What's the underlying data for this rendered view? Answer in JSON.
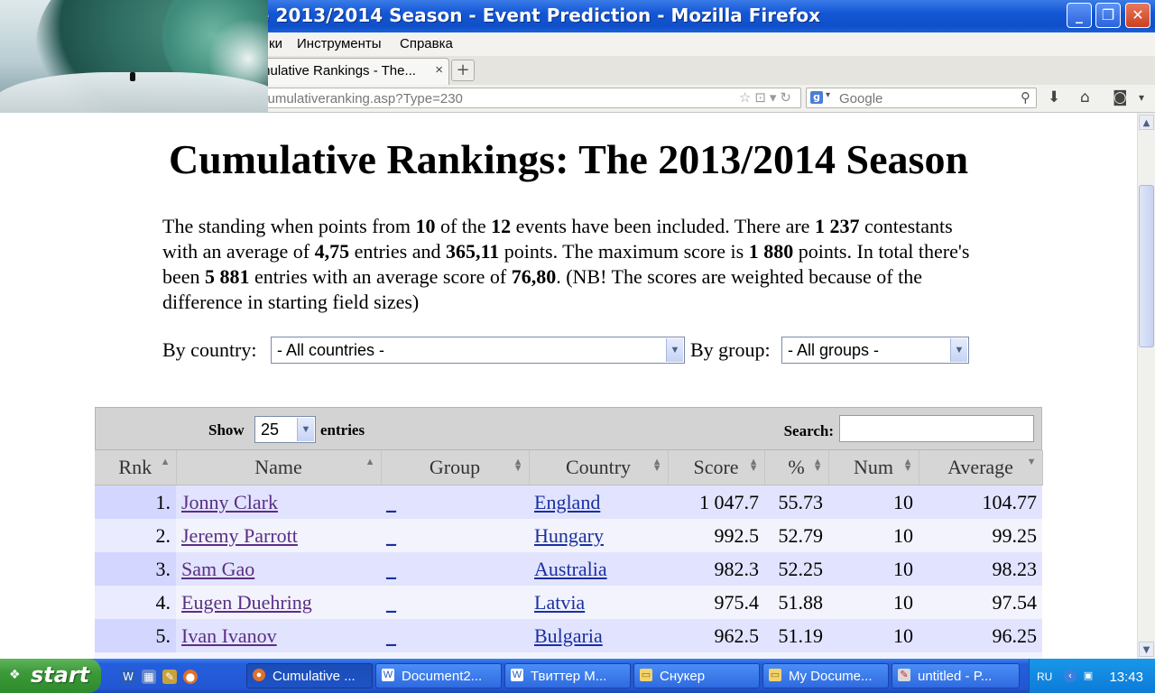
{
  "window": {
    "title": "e 2013/2014 Season - Event Prediction - Mozilla Firefox",
    "min_symbol": "_",
    "max_symbol": "❐",
    "close_symbol": "✕"
  },
  "menu": [
    "ки",
    "Инструменты",
    "Справка"
  ],
  "tab": {
    "label": "mulative Rankings - The...",
    "close": "×",
    "new": "+"
  },
  "nav": {
    "url": "cumulativeranking.asp?Type=230",
    "url_icons": "☆⊡▾↻",
    "search_engine_badge": "g",
    "search_caret": "▾",
    "search_placeholder": "Google",
    "search_icon": "⚲",
    "download_icon": "⬇",
    "home_icon": "⌂",
    "pocket_icon": "◙",
    "menu_caret": "▾"
  },
  "page": {
    "title": "Cumulative Rankings: The 2013/2014 Season",
    "summary": {
      "t1": "The standing when points from ",
      "events_included": "10",
      "t2": " of the ",
      "events_total": "12",
      "t3": " events have been included. There are ",
      "contestants": "1 237",
      "t4": " contestants with an average of ",
      "avg_entries": "4,75",
      "t5": " entries and ",
      "avg_points": "365,11",
      "t6": " points. The maximum score is ",
      "max_score": "1 880",
      "t7": " points. In total there's been ",
      "total_entries": "5 881",
      "t8": " entries with an average score of ",
      "avg_score": "76,80",
      "t9": ". (NB! The scores are weighted because of the difference in starting field sizes)"
    },
    "filters": {
      "country_label": "By country:",
      "country_value": "- All countries -",
      "group_label": "By group:",
      "group_value": "- All groups -",
      "arrow": "▼"
    }
  },
  "table": {
    "show_label": "Show",
    "show_value": "25",
    "entries_label": "entries",
    "search_label": "Search:",
    "search_value": "",
    "headers": [
      "Rnk",
      "Name",
      "Group",
      "Country",
      "Score",
      "%",
      "Num",
      "Average"
    ],
    "rows": [
      {
        "rank": "1.",
        "name": "Jonny Clark",
        "group": "_",
        "country": "England",
        "score": "1 047.7",
        "pct": "55.73",
        "num": "10",
        "avg": "104.77"
      },
      {
        "rank": "2.",
        "name": "Jeremy Parrott",
        "group": "_",
        "country": "Hungary",
        "score": "992.5",
        "pct": "52.79",
        "num": "10",
        "avg": "99.25"
      },
      {
        "rank": "3.",
        "name": "Sam Gao",
        "group": "_",
        "country": "Australia",
        "score": "982.3",
        "pct": "52.25",
        "num": "10",
        "avg": "98.23"
      },
      {
        "rank": "4.",
        "name": "Eugen Duehring",
        "group": "_",
        "country": "Latvia",
        "score": "975.4",
        "pct": "51.88",
        "num": "10",
        "avg": "97.54"
      },
      {
        "rank": "5.",
        "name": "Ivan Ivanov",
        "group": "_",
        "country": "Bulgaria",
        "score": "962.5",
        "pct": "51.19",
        "num": "10",
        "avg": "96.25"
      }
    ]
  },
  "taskbar": {
    "start_label": "start",
    "items": [
      "Cumulative ...",
      "Document2...",
      "Твиттер М...",
      "Снукер",
      "My Docume...",
      "untitled - P..."
    ],
    "lang": "RU",
    "clock": "13:43"
  }
}
